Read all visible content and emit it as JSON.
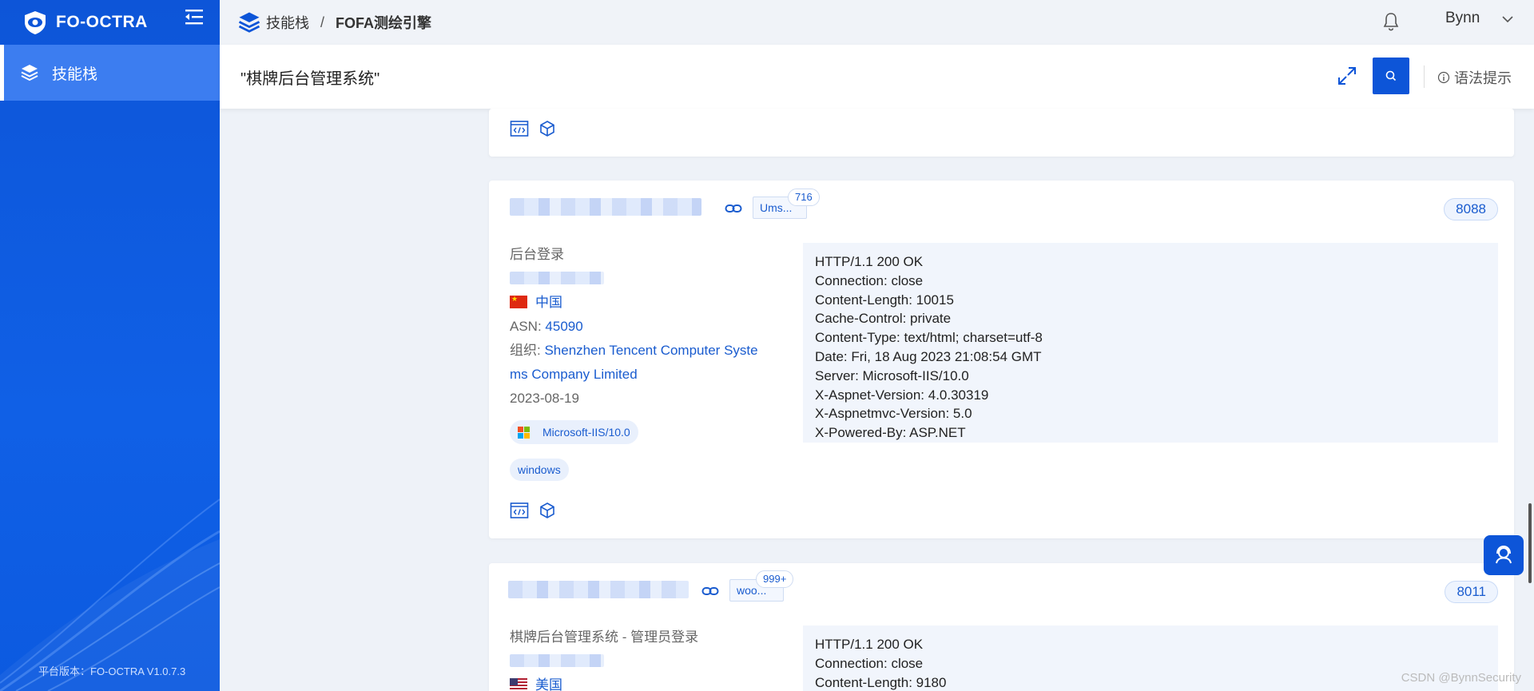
{
  "app": {
    "brand": "FO-OCTRA",
    "version": "平台版本：FO-OCTRA V1.0.7.3"
  },
  "sidebar": {
    "items": [
      {
        "label": "技能栈",
        "icon": "layers-icon"
      }
    ]
  },
  "header": {
    "crumb_root": "技能栈",
    "crumb_sep": "/",
    "crumb_current": "FOFA测绘引擎",
    "user": "Bynn"
  },
  "search": {
    "query": "\"棋牌后台管理系统\"",
    "hint": "语法提示"
  },
  "results": [
    {
      "tag": "Ums...",
      "count": "716",
      "port": "8088",
      "title": "后台登录",
      "country": "中国",
      "asn_label": "ASN: ",
      "asn": "45090",
      "org_label": "组织: ",
      "org_line1": "Shenzhen Tencent Computer Syste",
      "org_line2": "ms Company Limited",
      "date": "2023-08-19",
      "server_tag": "Microsoft-IIS/10.0",
      "os_tag": "windows",
      "headers": [
        "HTTP/1.1 200 OK",
        "Connection: close",
        "Content-Length: 10015",
        "Cache-Control: private",
        "Content-Type: text/html; charset=utf-8",
        "Date: Fri, 18 Aug 2023 21:08:54 GMT",
        "Server: Microsoft-IIS/10.0",
        "X-Aspnet-Version: 4.0.30319",
        "X-Aspnetmvc-Version: 5.0",
        "X-Powered-By: ASP.NET"
      ]
    },
    {
      "tag": "woo...",
      "count": "999+",
      "port": "8011",
      "title": "棋牌后台管理系统 - 管理员登录",
      "country": "美国",
      "headers": [
        "HTTP/1.1 200 OK",
        "Connection: close",
        "Content-Length: 9180"
      ]
    }
  ],
  "watermark": "CSDN @BynnSecurity",
  "colors": {
    "primary": "#0d55d8",
    "link": "#1a5ccf",
    "header_bg": "#f1f5fc"
  }
}
